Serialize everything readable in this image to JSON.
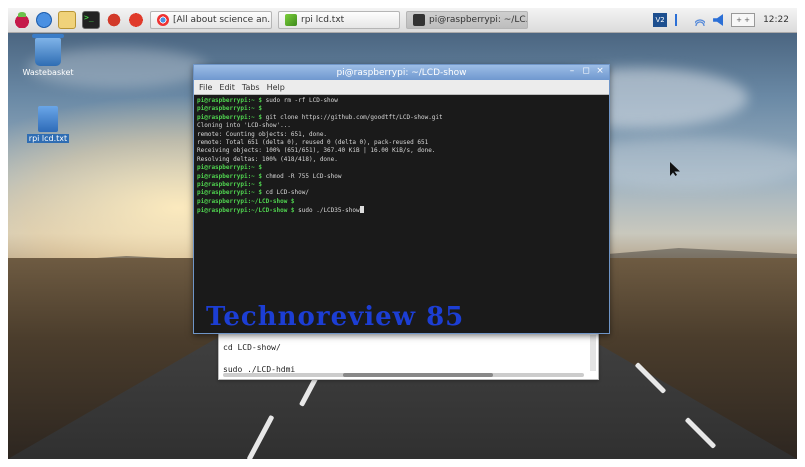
{
  "taskbar": {
    "launchers": [
      "raspberry-menu-icon",
      "browser-icon",
      "file-manager-icon",
      "terminal-icon",
      "mathematica-icon",
      "wolfram-icon"
    ],
    "windows": [
      {
        "label": "[All about science an..",
        "icon": "chrome-icon",
        "active": false
      },
      {
        "label": "rpi lcd.txt",
        "icon": "text-editor-icon",
        "active": false
      },
      {
        "label": "pi@raspberrypi: ~/LC..",
        "icon": "terminal-icon",
        "active": true
      }
    ],
    "tray": {
      "vnc_label": "V2",
      "cpu_label": "+ +",
      "clock": "12:22"
    }
  },
  "desktop": {
    "icons": [
      {
        "label": "Wastebasket",
        "icon": "wastebasket-icon"
      },
      {
        "label": "rpi lcd.txt",
        "icon": "text-file-icon"
      }
    ]
  },
  "terminal": {
    "title": "pi@raspberrypi: ~/LCD-show",
    "controls": [
      "–",
      "◻",
      "×"
    ],
    "menu": [
      "File",
      "Edit",
      "Tabs",
      "Help"
    ],
    "lines": [
      {
        "prompt": "pi@raspberrypi:~ $",
        "text": " sudo rm -rf LCD-show"
      },
      {
        "prompt": "pi@raspberrypi:~ $",
        "text": ""
      },
      {
        "prompt": "pi@raspberrypi:~ $",
        "text": " git clone https://github.com/goodtft/LCD-show.git"
      },
      {
        "prompt": "",
        "text": "Cloning into 'LCD-show'..."
      },
      {
        "prompt": "",
        "text": "remote: Counting objects: 651, done."
      },
      {
        "prompt": "",
        "text": "remote: Total 651 (delta 0), reused 0 (delta 0), pack-reused 651"
      },
      {
        "prompt": "",
        "text": "Receiving objects: 100% (651/651), 367.40 KiB | 16.00 KiB/s, done."
      },
      {
        "prompt": "",
        "text": "Resolving deltas: 100% (418/418), done."
      },
      {
        "prompt": "pi@raspberrypi:~ $",
        "text": ""
      },
      {
        "prompt": "pi@raspberrypi:~ $",
        "text": " chmod -R 755 LCD-show"
      },
      {
        "prompt": "pi@raspberrypi:~ $",
        "text": ""
      },
      {
        "prompt": "pi@raspberrypi:~ $",
        "text": " cd LCD-show/"
      },
      {
        "prompt": "pi@raspberrypi:~/LCD-show $",
        "text": ""
      },
      {
        "prompt": "pi@raspberrypi:~/LCD-show $",
        "text": " sudo ./LCD35-show"
      }
    ]
  },
  "watermark": "Technoreview 85",
  "editor": {
    "lines": [
      "cd LCD-show/",
      "",
      "sudo ./LCD-hdmi"
    ]
  }
}
